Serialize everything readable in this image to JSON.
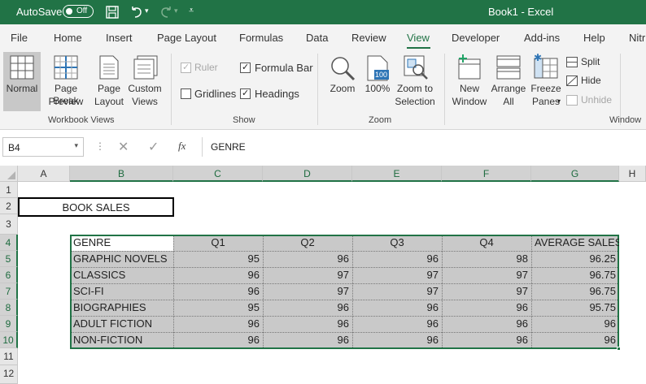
{
  "window": {
    "autosave_label": "AutoSave",
    "autosave_state": "Off",
    "title": "Book1  -  Excel",
    "accent_color": "#217346"
  },
  "menu": {
    "tabs": [
      "File",
      "Home",
      "Insert",
      "Page Layout",
      "Formulas",
      "Data",
      "Review",
      "View",
      "Developer",
      "Add-ins",
      "Help",
      "Nitr"
    ],
    "active": "View"
  },
  "ribbon": {
    "workbook_views": {
      "label": "Workbook Views",
      "normal": "Normal",
      "page_break_1": "Page Break",
      "page_break_2": "Preview",
      "page_layout_1": "Page",
      "page_layout_2": "Layout",
      "custom_1": "Custom",
      "custom_2": "Views"
    },
    "show": {
      "label": "Show",
      "ruler": "Ruler",
      "ruler_checked": true,
      "ruler_disabled": true,
      "gridlines": "Gridlines",
      "gridlines_checked": false,
      "formula_bar": "Formula Bar",
      "formula_bar_checked": true,
      "headings": "Headings",
      "headings_checked": true
    },
    "zoom": {
      "label": "Zoom",
      "zoom": "Zoom",
      "hundred": "100%",
      "hundred_icon_text": "100",
      "zoom_sel_1": "Zoom to",
      "zoom_sel_2": "Selection"
    },
    "window": {
      "label": "Window",
      "new_1": "New",
      "new_2": "Window",
      "arrange_1": "Arrange",
      "arrange_2": "All",
      "freeze_1": "Freeze",
      "freeze_2": "Panes",
      "split": "Split",
      "hide": "Hide",
      "unhide": "Unhide"
    }
  },
  "formula_bar": {
    "name_box": "B4",
    "fx": "fx",
    "content": "GENRE"
  },
  "sheet": {
    "columns": [
      "A",
      "B",
      "C",
      "D",
      "E",
      "F",
      "G",
      "H"
    ],
    "rows": [
      "1",
      "2",
      "3",
      "4",
      "5",
      "6",
      "7",
      "8",
      "9",
      "10",
      "11",
      "12"
    ],
    "title": "BOOK SALES",
    "table_headers": [
      "GENRE",
      "Q1",
      "Q2",
      "Q3",
      "Q4",
      "AVERAGE SALES"
    ],
    "table_rows": [
      [
        "GRAPHIC NOVELS",
        "95",
        "96",
        "96",
        "98",
        "96.25"
      ],
      [
        "CLASSICS",
        "96",
        "97",
        "97",
        "97",
        "96.75"
      ],
      [
        "SCI-FI",
        "96",
        "97",
        "97",
        "97",
        "96.75"
      ],
      [
        "BIOGRAPHIES",
        "95",
        "96",
        "96",
        "96",
        "95.75"
      ],
      [
        "ADULT FICTION",
        "96",
        "96",
        "96",
        "96",
        "96"
      ],
      [
        "NON-FICTION",
        "96",
        "96",
        "96",
        "96",
        "96"
      ]
    ]
  }
}
